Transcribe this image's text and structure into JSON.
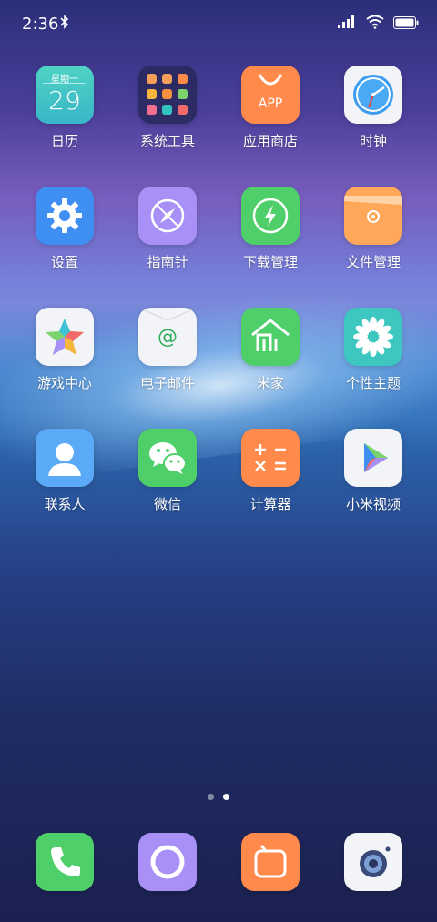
{
  "status": {
    "time": "2:36"
  },
  "apps": [
    {
      "label": "日历",
      "icon": "calendar-icon",
      "weekday": "星期一",
      "day": "29"
    },
    {
      "label": "系统工具",
      "icon": "system-tools-folder-icon"
    },
    {
      "label": "应用商店",
      "icon": "app-store-icon",
      "text": "APP"
    },
    {
      "label": "时钟",
      "icon": "clock-icon"
    },
    {
      "label": "设置",
      "icon": "settings-gear-icon"
    },
    {
      "label": "指南针",
      "icon": "compass-icon"
    },
    {
      "label": "下载管理",
      "icon": "download-manager-icon"
    },
    {
      "label": "文件管理",
      "icon": "file-manager-icon"
    },
    {
      "label": "游戏中心",
      "icon": "game-center-star-icon"
    },
    {
      "label": "电子邮件",
      "icon": "email-icon",
      "text": "@"
    },
    {
      "label": "米家",
      "icon": "mi-home-icon"
    },
    {
      "label": "个性主题",
      "icon": "themes-flower-icon"
    },
    {
      "label": "联系人",
      "icon": "contacts-icon"
    },
    {
      "label": "微信",
      "icon": "wechat-icon"
    },
    {
      "label": "计算器",
      "icon": "calculator-icon"
    },
    {
      "label": "小米视频",
      "icon": "mi-video-play-icon"
    }
  ],
  "dock": [
    {
      "icon": "phone-icon"
    },
    {
      "icon": "messaging-ring-icon"
    },
    {
      "icon": "browser-tv-icon"
    },
    {
      "icon": "camera-icon"
    }
  ],
  "pager": {
    "pages": 2,
    "active": 1
  }
}
